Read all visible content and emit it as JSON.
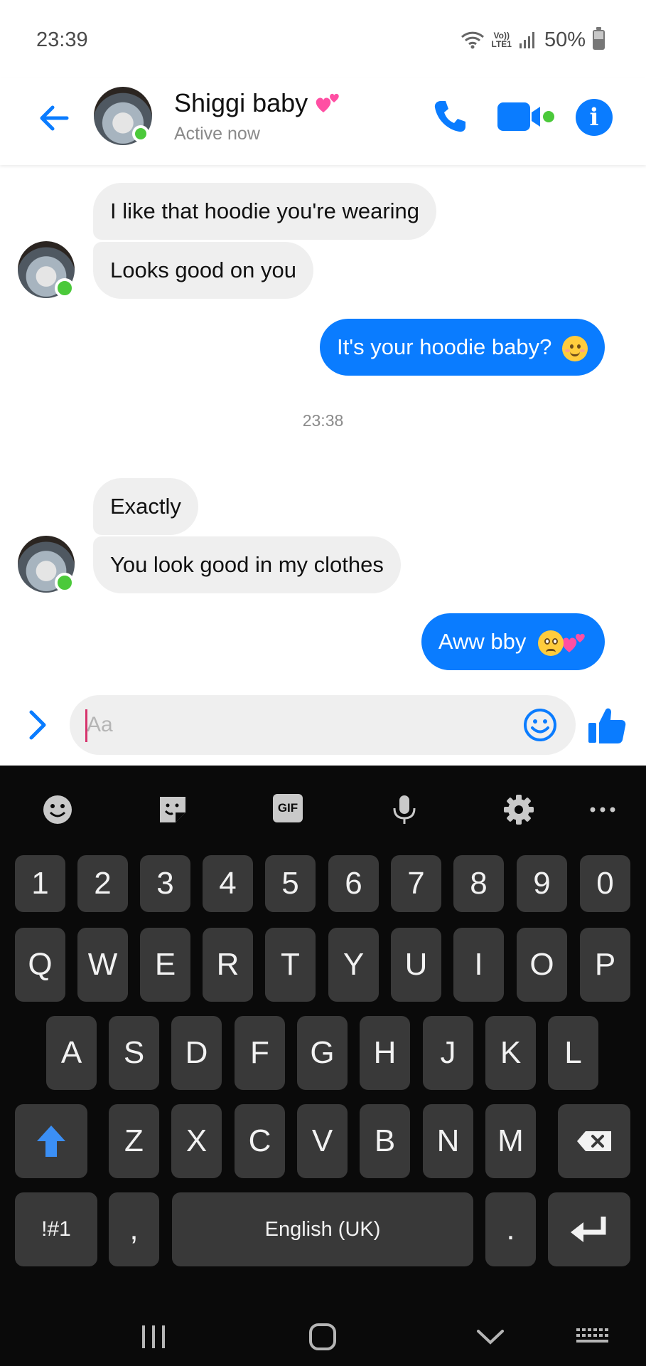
{
  "status_bar": {
    "time": "23:39",
    "network_top": "Vo))",
    "network_bottom": "LTE1",
    "battery_percent": "50%"
  },
  "header": {
    "contact_name": "Shiggi baby",
    "contact_status": "Active now",
    "accent_color": "#0a7cff",
    "online_color": "#4bc93a"
  },
  "messages": [
    {
      "direction": "incoming",
      "text": "I like that hoodie you're wearing"
    },
    {
      "direction": "incoming",
      "text": "Looks good on you"
    },
    {
      "direction": "outgoing",
      "text": "It's your hoodie baby?",
      "emoji": "smiling-blush-emoji"
    },
    {
      "type": "timestamp",
      "text": "23:38"
    },
    {
      "direction": "incoming",
      "text": "Exactly"
    },
    {
      "direction": "incoming",
      "text": "You look good in my clothes"
    },
    {
      "direction": "outgoing",
      "text": "Aww bby",
      "emoji": "pleading-face-and-hearts-emoji"
    }
  ],
  "composer": {
    "placeholder": "Aa",
    "value": ""
  },
  "keyboard": {
    "toolbar_icons": [
      "emoji-icon",
      "sticker-icon",
      "gif-icon",
      "microphone-icon",
      "settings-gear-icon",
      "more-icon"
    ],
    "gif_label": "GIF",
    "number_row": [
      "1",
      "2",
      "3",
      "4",
      "5",
      "6",
      "7",
      "8",
      "9",
      "0"
    ],
    "row1": [
      "Q",
      "W",
      "E",
      "R",
      "T",
      "Y",
      "U",
      "I",
      "O",
      "P"
    ],
    "row2": [
      "A",
      "S",
      "D",
      "F",
      "G",
      "H",
      "J",
      "K",
      "L"
    ],
    "row3": [
      "Z",
      "X",
      "C",
      "V",
      "B",
      "N",
      "M"
    ],
    "symbols_key": "!#1",
    "comma_key": ",",
    "space_key": "English (UK)",
    "period_key": ".",
    "shift_color": "#3b8ff5"
  },
  "nav_bar": {
    "icons": [
      "recent-apps-icon",
      "home-icon",
      "back-icon",
      "keyboard-switch-icon"
    ]
  }
}
